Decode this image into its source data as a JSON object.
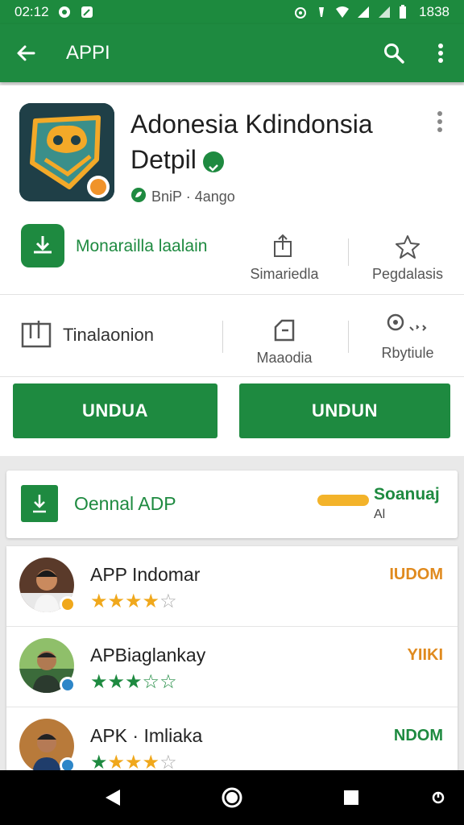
{
  "status_bar": {
    "time": "02:12",
    "battery": "1838"
  },
  "app_bar": {
    "title": "APPI",
    "icons": [
      "back-arrow-icon",
      "search-icon",
      "more-vert-icon"
    ]
  },
  "app": {
    "title_line1": "Adonesia Kdindonsia",
    "title_line2": "Detpil",
    "subtitle": "BniP · 4ango"
  },
  "stats_row1": {
    "main_label": "Monarailla laalain",
    "stat1_label": "Simariedla",
    "stat2_label": "Pegdalasis"
  },
  "stats_row2": {
    "info_label": "Tinalaonion",
    "stat1_label": "Maaodia",
    "stat2_label": "Rbytiule"
  },
  "buttons": {
    "left": "UNDUA",
    "right": "UNDUN"
  },
  "download_card": {
    "label": "Oennal ADP",
    "side_title": "Soanuaj",
    "side_sub": "Al"
  },
  "list": [
    {
      "name": "APP Indomar",
      "tag": "IUDOM",
      "tag_color": "#e08a1e",
      "rating": 4,
      "star_color": "#f0a81c"
    },
    {
      "name": "APBiaglankay",
      "tag": "YIIKI",
      "tag_color": "#e08a1e",
      "rating": 3,
      "star_color": "#1e8a40"
    },
    {
      "name": "APK · Imliaka",
      "tag": "NDOM",
      "tag_color": "#1e8a40",
      "rating": 4,
      "star_color": "#f0a81c"
    }
  ],
  "colors": {
    "primary": "#1e8a40",
    "accent": "#f3b32a"
  }
}
